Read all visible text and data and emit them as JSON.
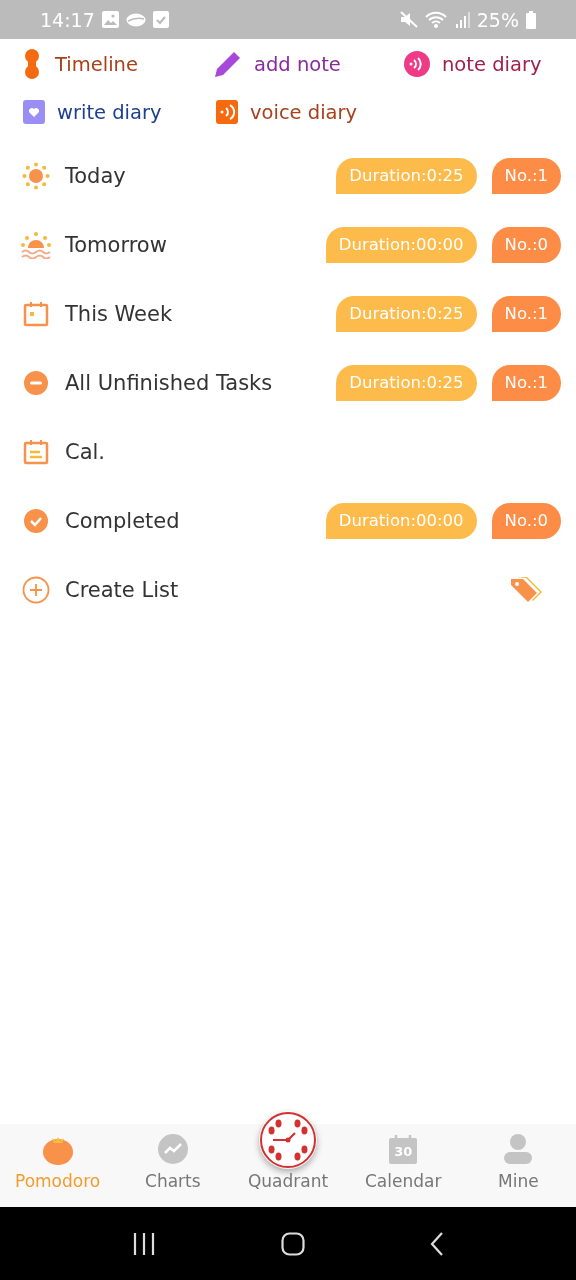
{
  "status_bar": {
    "time": "14:17",
    "battery": "25%"
  },
  "shortcuts": [
    {
      "label": "Timeline",
      "kind": "timeline",
      "color": "#a8411a"
    },
    {
      "label": "add note",
      "kind": "pencil",
      "color": "#8b2a9e"
    },
    {
      "label": "note diary",
      "kind": "sound",
      "color": "#a01f4c"
    },
    {
      "label": "write diary",
      "kind": "heart-book",
      "color": "#1d3f8f"
    },
    {
      "label": "voice diary",
      "kind": "voice-book",
      "color": "#a8411a"
    }
  ],
  "lists": [
    {
      "label": "Today",
      "kind": "sun",
      "duration": "Duration:0:25",
      "count": "No.:1"
    },
    {
      "label": "Tomorrow",
      "kind": "sunrise",
      "duration": "Duration:00:00",
      "count": "No.:0"
    },
    {
      "label": "This Week",
      "kind": "week",
      "duration": "Duration:0:25",
      "count": "No.:1"
    },
    {
      "label": "All Unfinished Tasks",
      "kind": "minus",
      "duration": "Duration:0:25",
      "count": "No.:1"
    },
    {
      "label": "Cal.",
      "kind": "calendar"
    },
    {
      "label": "Completed",
      "kind": "check",
      "duration": "Duration:00:00",
      "count": "No.:0"
    }
  ],
  "create_list": {
    "label": "Create List"
  },
  "bottom_nav": [
    {
      "label": "Pomodoro",
      "kind": "tomato",
      "selected": true
    },
    {
      "label": "Charts",
      "kind": "chart",
      "selected": false
    },
    {
      "label": "Quadrant",
      "kind": "clock",
      "selected": false
    },
    {
      "label": "Calendar",
      "kind": "calendar",
      "date": "30",
      "selected": false
    },
    {
      "label": "Mine",
      "kind": "person",
      "selected": false
    }
  ]
}
